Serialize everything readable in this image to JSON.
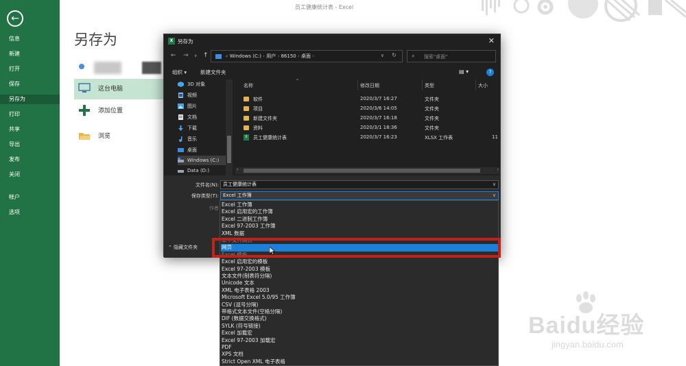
{
  "window": {
    "title": "员工健康统计表 - Excel"
  },
  "backstage": {
    "nav": [
      "信息",
      "新建",
      "打开",
      "保存",
      "另存为",
      "打印",
      "共享",
      "导出",
      "发布",
      "关闭",
      "帐户",
      "选项"
    ],
    "page_title": "另存为",
    "locations": [
      "这台电脑",
      "添加位置",
      "浏览"
    ]
  },
  "dialog": {
    "title": "另存为",
    "app_icon": "X",
    "address": [
      "Windows (C:)",
      "用户",
      "86150",
      "桌面"
    ],
    "search_placeholder": "搜索\"桌面\"",
    "toolbar": {
      "organize": "组织 ▾",
      "new_folder": "新建文件夹"
    },
    "tree": [
      "3D 对象",
      "视频",
      "图片",
      "文档",
      "下载",
      "音乐",
      "桌面",
      "Windows (C:)",
      "Data (D:)"
    ],
    "columns": {
      "name": "名称",
      "date": "修改日期",
      "type": "类型",
      "size": "大小"
    },
    "files": [
      {
        "name": "软件",
        "date": "2020/3/7 16:27",
        "type": "文件夹",
        "size": "",
        "kind": "folder"
      },
      {
        "name": "项目",
        "date": "2020/3/6 14:05",
        "type": "文件夹",
        "size": "",
        "kind": "folder"
      },
      {
        "name": "新建文件夹",
        "date": "2020/3/7 16:18",
        "type": "文件夹",
        "size": "",
        "kind": "folder"
      },
      {
        "name": "资料",
        "date": "2020/3/1 18:36",
        "type": "文件夹",
        "size": "",
        "kind": "folder"
      },
      {
        "name": "员工健康统计表",
        "date": "2020/3/7 16:23",
        "type": "XLSX 工作表",
        "size": "11",
        "kind": "xlsx"
      }
    ],
    "filename_label": "文件名(N):",
    "filename_value": "员工健康统计表",
    "savetype_label": "保存类型(T):",
    "savetype_value": "Excel 工作簿",
    "authors_label": "作者",
    "hide_folders": "隐藏文件夹"
  },
  "dropdown": {
    "items": [
      "Excel 工作簿",
      "Excel 启用宏的工作簿",
      "Excel 二进制工作簿",
      "Excel 97-2003 工作簿",
      "XML 数据",
      "单个文件网页",
      "网页",
      "Excel 模板",
      "Excel 启用宏的模板",
      "Excel 97-2003 模板",
      "文本文件(制表符分隔)",
      "Unicode 文本",
      "XML 电子表格 2003",
      "Microsoft Excel 5.0/95 工作簿",
      "CSV (逗号分隔)",
      "带格式文本文件(空格分隔)",
      "DIF (数据交换格式)",
      "SYLK (符号链接)",
      "Excel 加载宏",
      "Excel 97-2003 加载宏",
      "PDF",
      "XPS 文档",
      "Strict Open XML 电子表格"
    ],
    "highlighted": "网页"
  },
  "watermark": {
    "text": "Baidu经验",
    "url": "jingyan.baidu.com"
  }
}
